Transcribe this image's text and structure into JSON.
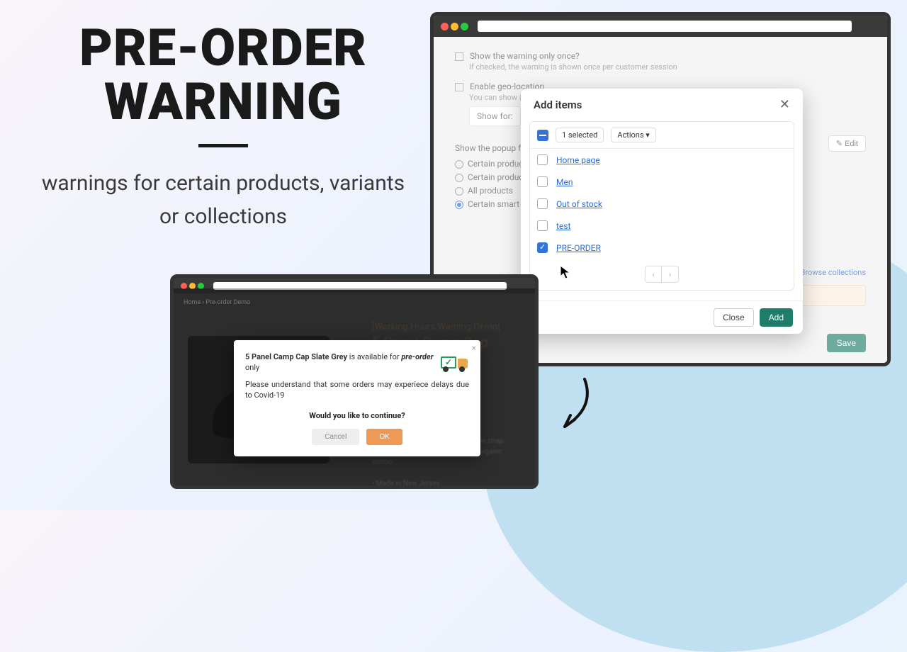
{
  "hero": {
    "title": "PRE-ORDER WARNING",
    "subtitle": "warnings for certain products, variants or collections"
  },
  "settings": {
    "show_once_label": "Show the warning only once?",
    "show_once_help": "If checked, the warning is shown once per customer session",
    "geo_label": "Enable geo-location",
    "geo_help": "You can show (or",
    "show_for_box": "Show for:",
    "edit_label": "Edit",
    "popup_for_label": "Show the popup for:",
    "radios": [
      {
        "label": "Certain products"
      },
      {
        "label": "Certain product va"
      },
      {
        "label": "All products"
      },
      {
        "label": "Certain smart or c"
      }
    ],
    "browse_label": "Browse collections",
    "save_label": "Save"
  },
  "modal": {
    "title": "Add items",
    "selected_count": "1 selected",
    "actions_label": "Actions",
    "items": [
      {
        "label": "Home page",
        "checked": false
      },
      {
        "label": "Men",
        "checked": false
      },
      {
        "label": "Out of stock",
        "checked": false
      },
      {
        "label": "test",
        "checked": false
      },
      {
        "label": "PRE-ORDER",
        "checked": true
      }
    ],
    "close_label": "Close",
    "add_label": "Add"
  },
  "product": {
    "crumbs": "Home › Pre-order Demo",
    "sub": "[Working Hours Warning Demo]",
    "title": "5 Panel Camp Cap",
    "para": "5 panel camping hat with adjustable strap. Made with recycled polyester and organic cotton.",
    "more": "• Made in New Jersey"
  },
  "pmodal": {
    "product_name": "5 Panel Camp Cap Slate Grey",
    "avail_mid": " is available for ",
    "preorder": "pre-order",
    "avail_end": " only",
    "line2": "Please understand that some orders may experiece delays due to Covid-19",
    "question": "Would you like to continue?",
    "cancel": "Cancel",
    "ok": "OK"
  }
}
